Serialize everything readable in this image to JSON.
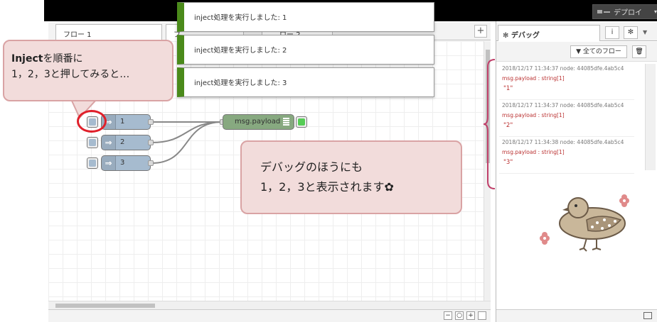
{
  "header": {
    "deploy_label": "デプロイ",
    "deploy_caret": "▾"
  },
  "tabs": {
    "items": [
      {
        "label": "フロー 1"
      },
      {
        "label": "フ"
      },
      {
        "label": "ロー 2"
      }
    ],
    "add": "+"
  },
  "notifications": [
    {
      "text": "inject処理を実行しました: 1"
    },
    {
      "text": "inject処理を実行しました: 2"
    },
    {
      "text": "inject処理を実行しました: 3"
    }
  ],
  "flow": {
    "inject_nodes": [
      {
        "label": "1"
      },
      {
        "label": "2"
      },
      {
        "label": "3"
      }
    ],
    "debug_node": {
      "label": "msg.payload"
    }
  },
  "sidebar": {
    "tab_label": "デバッグ",
    "tab_icon": "bug-icon",
    "info_label": "i",
    "filter_label": "全てのフロー",
    "messages": [
      {
        "meta": "2018/12/17 11:34:37   node: 44085dfe.4ab5c4",
        "topic": "msg.payload : string[1]",
        "value": "\"1\""
      },
      {
        "meta": "2018/12/17 11:34:37   node: 44085dfe.4ab5c4",
        "topic": "msg.payload : string[1]",
        "value": "\"2\""
      },
      {
        "meta": "2018/12/17 11:34:38   node: 44085dfe.4ab5c4",
        "topic": "msg.payload : string[1]",
        "value": "\"3\""
      }
    ]
  },
  "zoom": {
    "minus": "−",
    "reset": "○",
    "plus": "+"
  },
  "callouts": {
    "one_strong": "Inject",
    "one_line1": "を順番に",
    "one_line2": "1，2，3と押してみると…",
    "two_line1": "デバッグのほうにも",
    "two_line2": "1，2，3と表示されます✿"
  },
  "colors": {
    "inject": "#a6bbcf",
    "debug": "#87a980",
    "notify_accent": "#4a8a1a",
    "callout_bg": "#f2dcdb",
    "callout_border": "#d9a3a4",
    "ring": "#e0202a"
  }
}
